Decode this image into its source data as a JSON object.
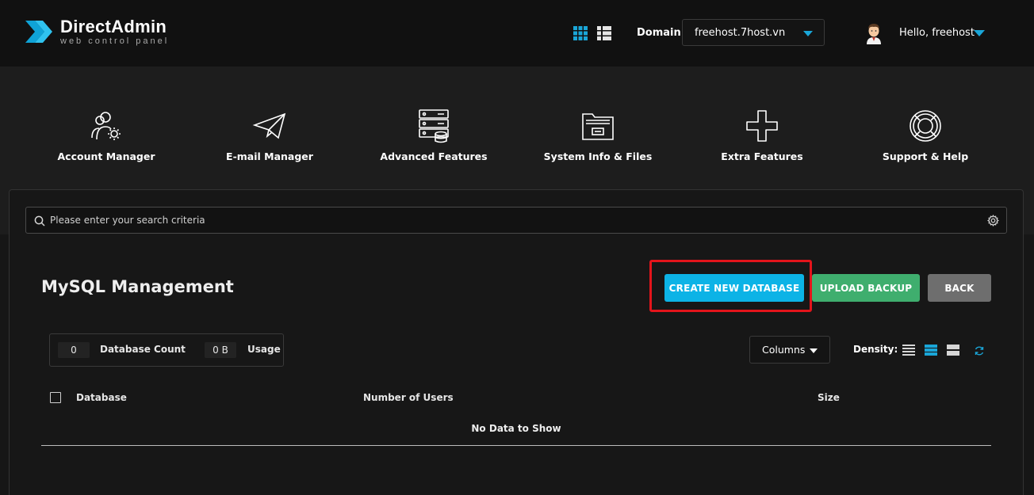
{
  "brand": {
    "name": "DirectAdmin",
    "tagline": "web control panel",
    "accent": "#1aa6d8"
  },
  "header": {
    "domain_label": "Domain",
    "domain_value": "freehost.7host.vn",
    "greeting": "Hello,",
    "username": "freehost"
  },
  "nav": [
    {
      "label": "Account Manager",
      "icon": "users-gear-icon"
    },
    {
      "label": "E-mail Manager",
      "icon": "paper-plane-icon"
    },
    {
      "label": "Advanced Features",
      "icon": "server-database-icon"
    },
    {
      "label": "System Info & Files",
      "icon": "folder-icon"
    },
    {
      "label": "Extra Features",
      "icon": "plus-icon"
    },
    {
      "label": "Support & Help",
      "icon": "lifebuoy-icon"
    }
  ],
  "search": {
    "placeholder": "Please enter your search criteria"
  },
  "page": {
    "title": "MySQL Management"
  },
  "actions": {
    "create": "CREATE NEW DATABASE",
    "upload": "UPLOAD BACKUP",
    "back": "BACK"
  },
  "stats": {
    "database_count_value": "0",
    "database_count_label": "Database Count",
    "usage_value": "0 B",
    "usage_label": "Usage"
  },
  "table_controls": {
    "columns_label": "Columns",
    "density_label": "Density:"
  },
  "table": {
    "columns": [
      "Database",
      "Number of Users",
      "Size"
    ],
    "empty_message": "No Data to Show"
  },
  "colors": {
    "create": "#0cb3e6",
    "upload": "#3fae6e",
    "back": "#6e6e6e",
    "highlight": "#e3141b"
  }
}
